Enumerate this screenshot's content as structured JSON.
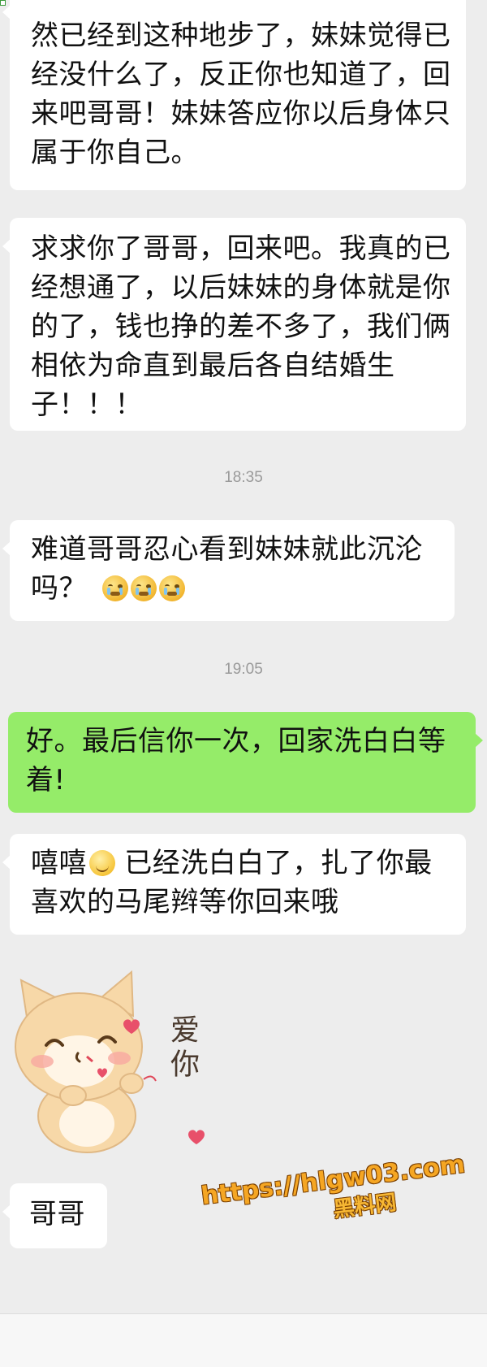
{
  "chat": {
    "messages": [
      {
        "id": "m1",
        "side": "incoming",
        "lines": [
          "然已经到这种地步了，妹妹觉得已",
          "经没什么了，反正你也知道了，回",
          "来吧哥哥！妹妹答应你以后身体只",
          "属于你自己。"
        ]
      },
      {
        "id": "m2",
        "side": "incoming",
        "lines": [
          "求求你了哥哥，回来吧。我真的已",
          "经想通了，以后妹妹的身体就是你",
          "的了，钱也挣的差不多了，我们俩",
          "相依为命直到最后各自结婚生",
          "子！！！"
        ]
      },
      {
        "id": "m3",
        "side": "incoming",
        "lines": [
          "难道哥哥忍心看到妹妹就此沉沦",
          "吗？"
        ],
        "emoji": [
          "crying-face-emoji",
          "crying-face-emoji",
          "crying-face-emoji"
        ]
      },
      {
        "id": "m4",
        "side": "outgoing",
        "lines": [
          "好。最后信你一次，回家洗白白等",
          "着!"
        ]
      },
      {
        "id": "m5",
        "side": "incoming",
        "lines_before_emoji": "嘻嘻",
        "emoji": "smiling-face-emoji",
        "lines_after_emoji": " 已经洗白白了，扎了你最",
        "line2": "喜欢的马尾辫等你回来哦"
      },
      {
        "id": "m6",
        "side": "incoming",
        "lines": [
          "哥哥"
        ]
      }
    ],
    "timestamps": [
      "18:35",
      "19:05"
    ],
    "sticker": {
      "icon": "cat-love-sticker",
      "text": "爱你"
    }
  },
  "watermark": {
    "url": "https://hlgw03.com",
    "label": "黑料网"
  },
  "colors": {
    "background": "#ededed",
    "incoming_bubble": "#ffffff",
    "outgoing_bubble": "#95ec69",
    "timestamp_text": "#9a9a9a",
    "watermark": "#f5a623"
  }
}
